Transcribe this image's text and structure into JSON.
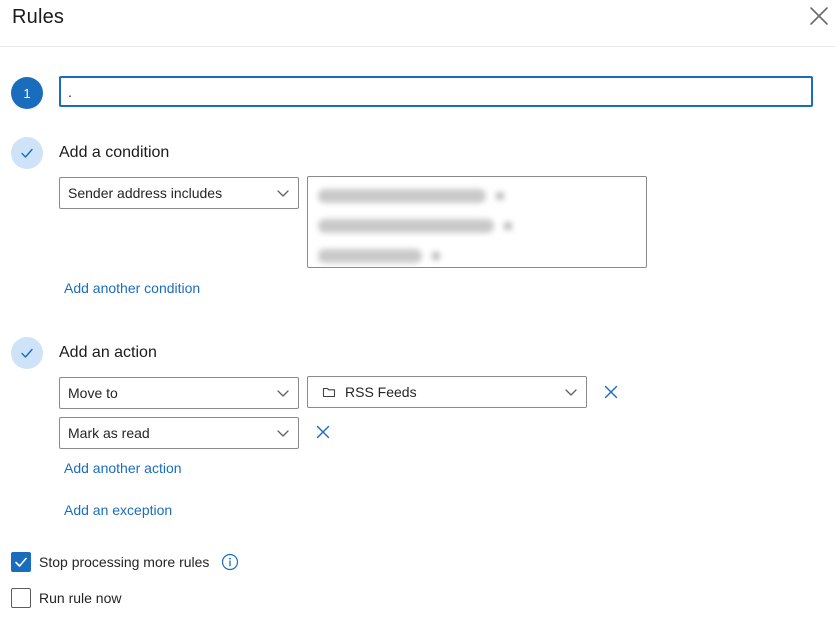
{
  "header": {
    "title": "Rules"
  },
  "step1": {
    "number": "1",
    "name_value": "."
  },
  "condition": {
    "title": "Add a condition",
    "type_label": "Sender address includes",
    "addresses": [
      {
        "label": "(redacted)"
      },
      {
        "label": "(redacted)"
      },
      {
        "label": "(redacted)"
      }
    ],
    "add_another_label": "Add another condition"
  },
  "action": {
    "title": "Add an action",
    "rows": [
      {
        "type_label": "Move to",
        "target_label": "RSS Feeds"
      },
      {
        "type_label": "Mark as read"
      }
    ],
    "add_another_label": "Add another action",
    "add_exception_label": "Add an exception"
  },
  "options": {
    "stop_processing": {
      "label": "Stop processing more rules",
      "checked": true
    },
    "run_now": {
      "label": "Run rule now",
      "checked": false
    }
  },
  "colors": {
    "accent": "#1a6dbd",
    "check_bg": "#cfe3f8"
  }
}
